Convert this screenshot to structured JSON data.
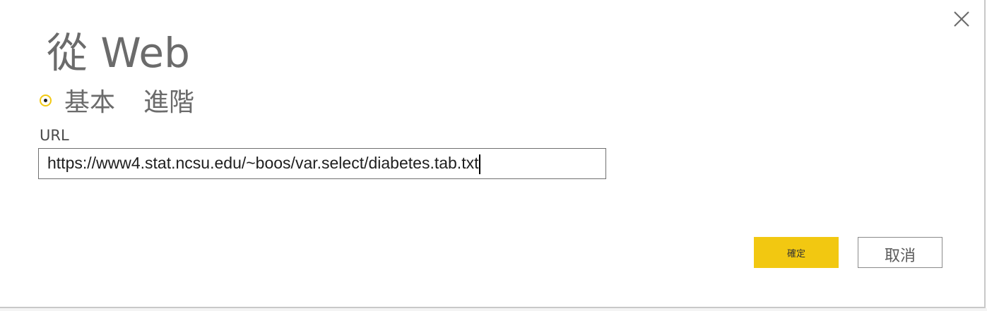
{
  "dialog": {
    "title": "從 Web",
    "close_icon": "close-icon"
  },
  "mode": {
    "options": [
      {
        "label": "基本",
        "selected": true
      },
      {
        "label": "進階",
        "selected": false
      }
    ]
  },
  "url_field": {
    "label": "URL",
    "value": "https://www4.stat.ncsu.edu/~boos/var.select/diabetes.tab.txt"
  },
  "buttons": {
    "ok_label": "確定",
    "cancel_label": "取消"
  },
  "colors": {
    "accent": "#f2c811",
    "title_gray": "#6b6b6b"
  }
}
